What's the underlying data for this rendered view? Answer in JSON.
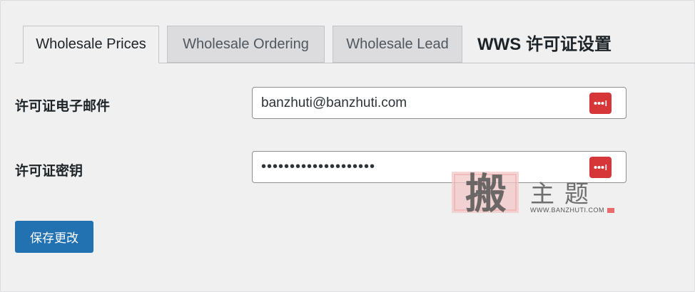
{
  "tabs": [
    {
      "label": "Wholesale Prices",
      "active": true
    },
    {
      "label": "Wholesale Ordering",
      "active": false
    },
    {
      "label": "Wholesale Lead",
      "active": false
    }
  ],
  "page_title": "WWS 许可证设置",
  "form": {
    "email": {
      "label": "许可证电子邮件",
      "value": "banzhuti@banzhuti.com"
    },
    "license_key": {
      "label": "许可证密钥",
      "value": "••••••••••••••••••••"
    },
    "password_manager_icon": "password-manager-icon"
  },
  "save_button_label": "保存更改",
  "watermark": {
    "seal_char": "搬",
    "text": "主题",
    "url": "WWW.BANZHUTI.COM"
  },
  "colors": {
    "primary": "#2271b1",
    "pm_red": "#d63638",
    "background": "#f0f0f1",
    "tab_inactive": "#dcdcde"
  }
}
